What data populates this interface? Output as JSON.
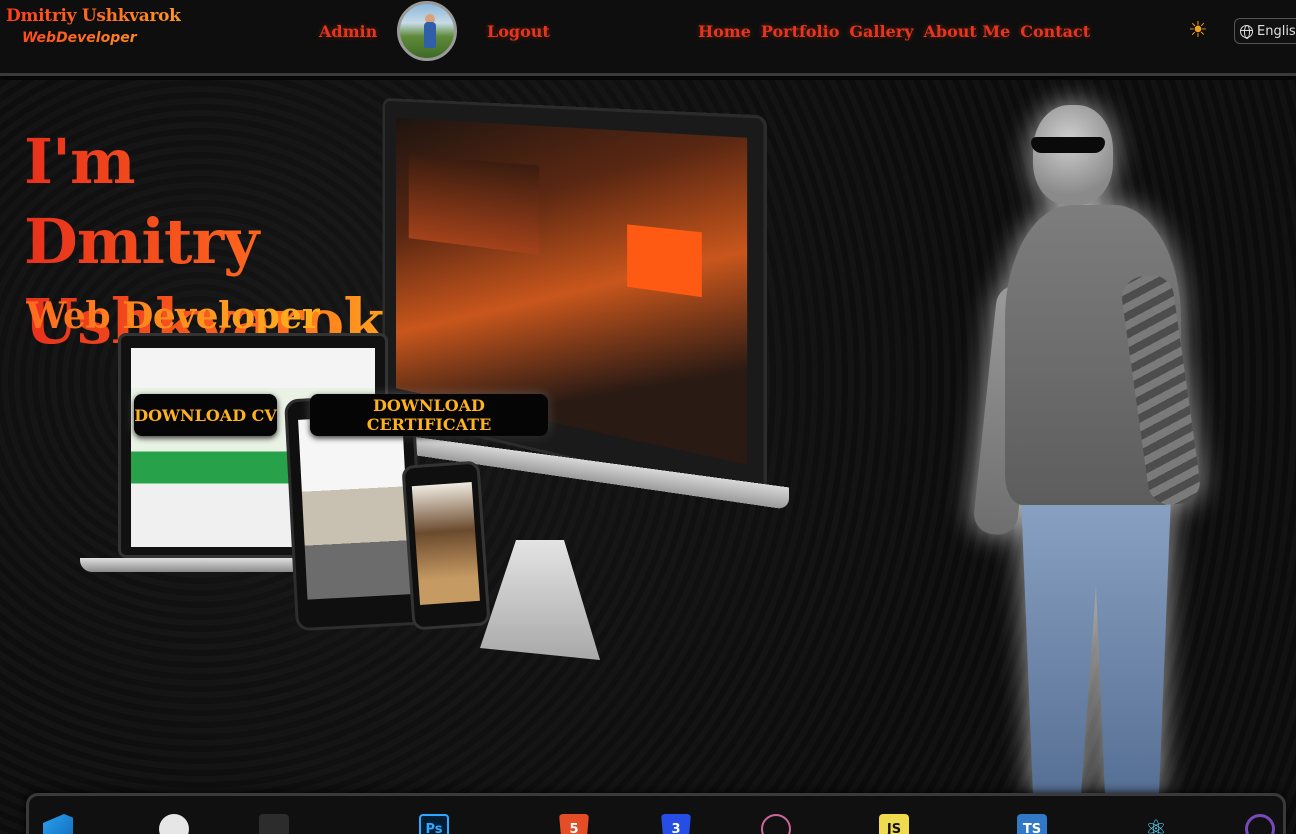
{
  "header": {
    "brand_name": "Dmitriy Ushkvarok",
    "brand_subtitle": "WebDeveloper",
    "admin_label": "Admin",
    "logout_label": "Logout",
    "nav": [
      "Home",
      "Portfolio",
      "Gallery",
      "About Me",
      "Contact"
    ],
    "theme_icon": "sun-icon",
    "language": "English"
  },
  "hero": {
    "title": "I'm Dmitry Ushkvarok",
    "subtitle": "Web Developer",
    "download_cv_label": "DOWNLOAD CV",
    "download_certificate_label": "DOWNLOAD CERTIFICATE"
  },
  "skills": {
    "icons": [
      {
        "name": "vscode-icon",
        "glyph": "",
        "color": "#1f8fe0"
      },
      {
        "name": "github-icon",
        "glyph": "",
        "color": "#e6e6e6"
      },
      {
        "name": "figma-icon",
        "glyph": "",
        "color": "#f24e1e"
      },
      {
        "name": "photoshop-icon",
        "glyph": "Ps",
        "color": "#31a8ff"
      },
      {
        "name": "html5-icon",
        "glyph": "5",
        "color": "#e44d26"
      },
      {
        "name": "css3-icon",
        "glyph": "3",
        "color": "#264de4"
      },
      {
        "name": "sass-icon",
        "glyph": "",
        "color": "#cd6799"
      },
      {
        "name": "javascript-icon",
        "glyph": "JS",
        "color": "#f0db4f"
      },
      {
        "name": "typescript-icon",
        "glyph": "TS",
        "color": "#3178c6"
      },
      {
        "name": "react-icon",
        "glyph": "⚛",
        "color": "#61dafb"
      },
      {
        "name": "redux-icon",
        "glyph": "",
        "color": "#764abc"
      }
    ]
  },
  "colors": {
    "accent": "#e8341c",
    "accent_warm": "#ffb21e",
    "background": "#0b0b0b"
  }
}
